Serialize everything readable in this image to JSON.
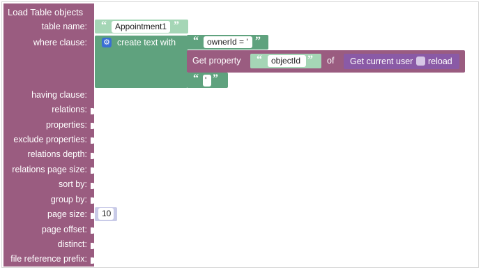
{
  "block": {
    "title": "Load Table objects",
    "labels": {
      "table_name": "table name:",
      "where_clause": "where clause:",
      "having_clause": "having clause:",
      "relations": "relations:",
      "properties": "properties:",
      "exclude_properties": "exclude properties:",
      "relations_depth": "relations depth:",
      "relations_page_size": "relations page size:",
      "sort_by": "sort by:",
      "group_by": "group by:",
      "page_size": "page size:",
      "page_offset": "page offset:",
      "distinct": "distinct:",
      "file_reference_prefix": "file reference prefix:"
    }
  },
  "table_name_value": "Appointment1",
  "create_text": {
    "label": "create text with",
    "part1": "ownerId = '",
    "part3": "'"
  },
  "get_property": {
    "label": "Get property",
    "property_name": "objectId",
    "of_label": "of",
    "current_user_label": "Get current user",
    "reload_label": "reload"
  },
  "page_size_value": "10",
  "quote_open": "“",
  "quote_close": "”",
  "colors": {
    "main_block": "#9a5c80",
    "text_block": "#a5d6b6",
    "create_text_block": "#5fa27e",
    "get_property_block": "#9a5c80",
    "current_user_block": "#8a5aa6",
    "number_block": "#c9cbe8"
  },
  "icons": {
    "mutator": "gear-icon",
    "reload": "checkbox-icon"
  }
}
